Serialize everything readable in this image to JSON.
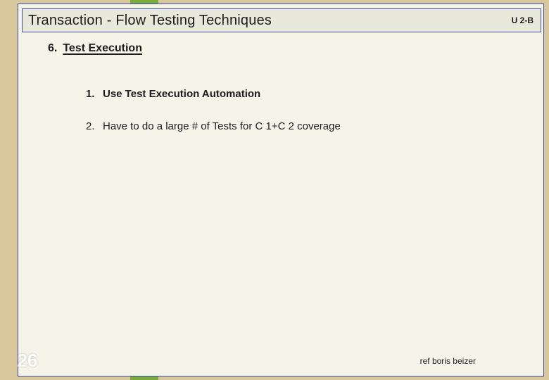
{
  "header": {
    "title": "Transaction - Flow Testing  Techniques",
    "unit_label": "U 2-B"
  },
  "section": {
    "number": "6.",
    "heading": "Test Execution"
  },
  "items": [
    {
      "number": "1.",
      "text": "Use Test Execution Automation"
    },
    {
      "number": "2.",
      "text": "Have to do a large # of Tests for C 1+C 2 coverage"
    }
  ],
  "footer": {
    "page_number": "26",
    "reference": "ref boris beizer"
  }
}
